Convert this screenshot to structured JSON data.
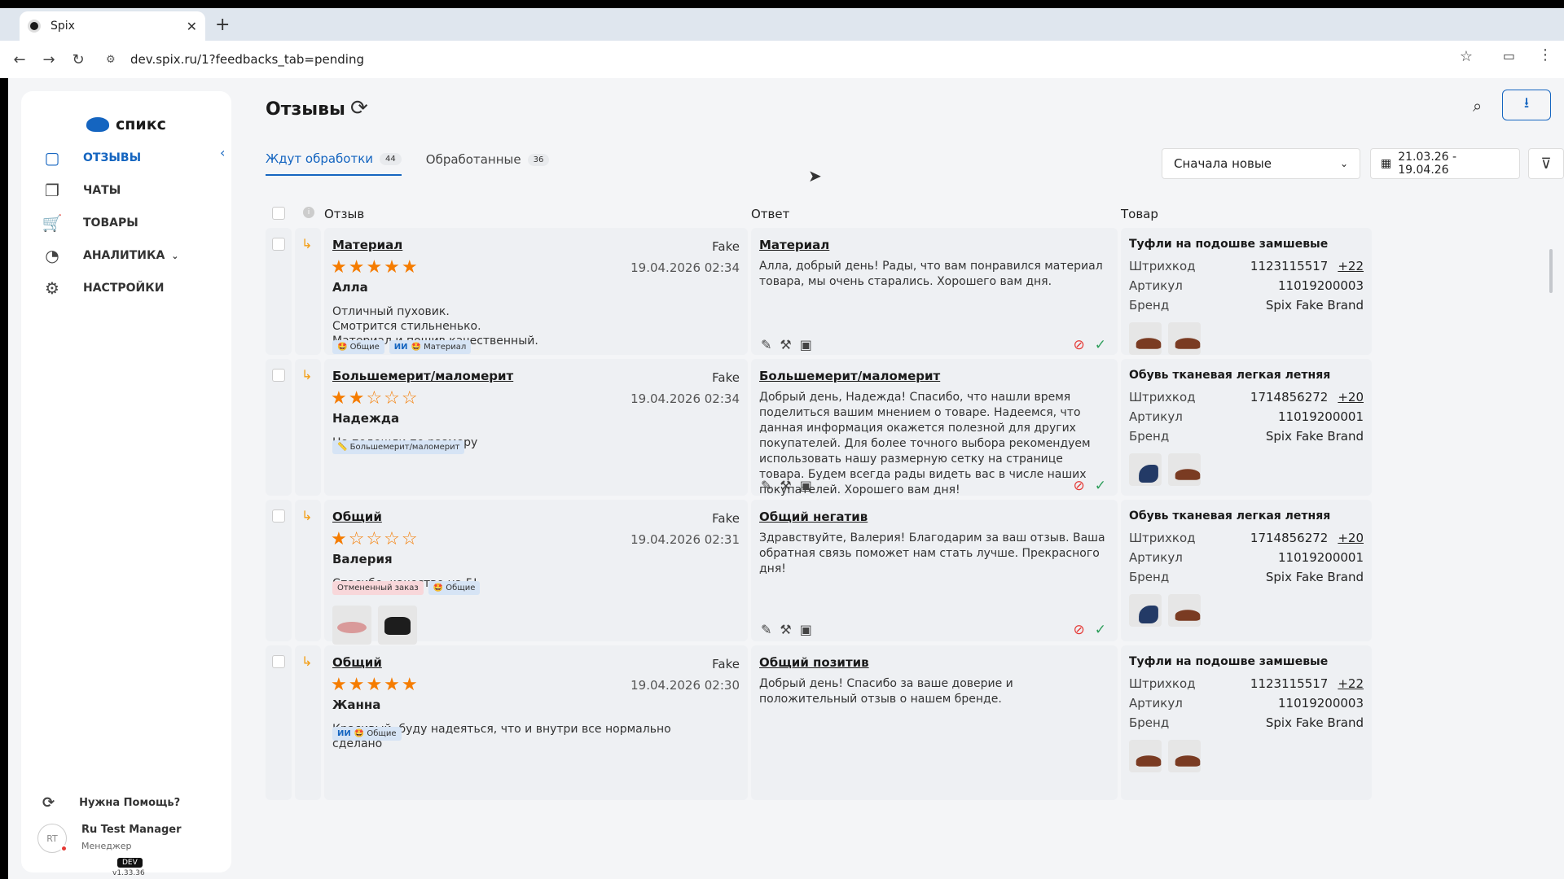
{
  "browser": {
    "tab_title": "Spix",
    "url": "dev.spix.ru/1?feedbacks_tab=pending"
  },
  "sidebar": {
    "logo_text": "спикс",
    "nav": [
      {
        "label": "ОТЗЫВЫ",
        "icon": "message-square-icon"
      },
      {
        "label": "ЧАТЫ",
        "icon": "chat-icon"
      },
      {
        "label": "ТОВАРЫ",
        "icon": "cart-icon"
      },
      {
        "label": "АНАЛИТИКА",
        "icon": "pie-chart-icon"
      },
      {
        "label": "НАСТРОЙКИ",
        "icon": "gear-icon"
      }
    ],
    "help": "Нужна Помощь?",
    "user": {
      "initials": "RT",
      "name": "Ru Test Manager",
      "role": "Менеджер"
    },
    "env": "DEV",
    "version": "v1.33.36"
  },
  "header": {
    "title": "Отзывы"
  },
  "tabs": [
    {
      "label": "Ждут обработки",
      "count": "44"
    },
    {
      "label": "Обработанные",
      "count": "36"
    }
  ],
  "filters": {
    "sort": "Сначала новые",
    "date_range": "21.03.26 - 19.04.26"
  },
  "columns": {
    "review": "Отзыв",
    "answer": "Ответ",
    "product": "Товар"
  },
  "product_labels": {
    "barcode": "Штрихкод",
    "article": "Артикул",
    "brand": "Бренд"
  },
  "rows": [
    {
      "topic": "Материал",
      "source": "Fake",
      "rating": 5,
      "date": "19.04.2026 02:34",
      "author": "Алла",
      "text": "Отличный пуховик.\nСмотрится стильненько.\nМатериал и пошив качественный.",
      "tags": [
        "🤩 Общие",
        "ИИ 🤩 Материал"
      ],
      "answer_topic": "Материал",
      "answer_text": "Алла, добрый день! Рады, что вам понравился материал товара, мы очень старались. Хорошего вам дня.",
      "product": {
        "name": "Туфли на подошве замшевые",
        "barcode": "1123115517",
        "barcode_more": "+22",
        "article": "11019200003",
        "brand": "Spix Fake Brand"
      }
    },
    {
      "topic": "Большемерит/маломерит",
      "source": "Fake",
      "rating": 2,
      "date": "19.04.2026 02:34",
      "author": "Надежда",
      "text": "Не подошли по размеру",
      "tags": [
        "📏 Большемерит/маломерит"
      ],
      "answer_topic": "Большемерит/маломерит",
      "answer_text": "Добрый день, Надежда! Спасибо, что нашли время поделиться вашим мнением о товаре. Надеемся, что данная информация окажется полезной для других покупателей. Для более точного выбора рекомендуем использовать нашу размерную сетку на странице товара. Будем всегда рады видеть вас в числе наших покупателей. Хорошего вам дня!",
      "product": {
        "name": "Обувь тканевая легкая летняя",
        "barcode": "1714856272",
        "barcode_more": "+20",
        "article": "11019200001",
        "brand": "Spix Fake Brand"
      }
    },
    {
      "topic": "Общий",
      "source": "Fake",
      "rating": 1,
      "date": "19.04.2026 02:31",
      "author": "Валерия",
      "text": "Спасибо, качество на 5!",
      "tags": [
        "Отмененный заказ",
        "🤩 Общие"
      ],
      "answer_topic": "Общий негатив",
      "answer_text": "Здравствуйте, Валерия! Благодарим за ваш отзыв. Ваша обратная связь поможет нам стать лучше. Прекрасного дня!",
      "product": {
        "name": "Обувь тканевая легкая летняя",
        "barcode": "1714856272",
        "barcode_more": "+20",
        "article": "11019200001",
        "brand": "Spix Fake Brand"
      }
    },
    {
      "topic": "Общий",
      "source": "Fake",
      "rating": 5,
      "date": "19.04.2026 02:30",
      "author": "Жанна",
      "text": "Красивый, буду надеяться, что и внутри все нормально сделано",
      "tags": [
        "ИИ 🤩 Общие"
      ],
      "answer_topic": "Общий позитив",
      "answer_text": "Добрый день! Спасибо за ваше доверие и положительный отзыв о нашем бренде.",
      "product": {
        "name": "Туфли на подошве замшевые",
        "barcode": "1123115517",
        "barcode_more": "+22",
        "article": "11019200003",
        "brand": "Spix Fake Brand"
      }
    }
  ]
}
